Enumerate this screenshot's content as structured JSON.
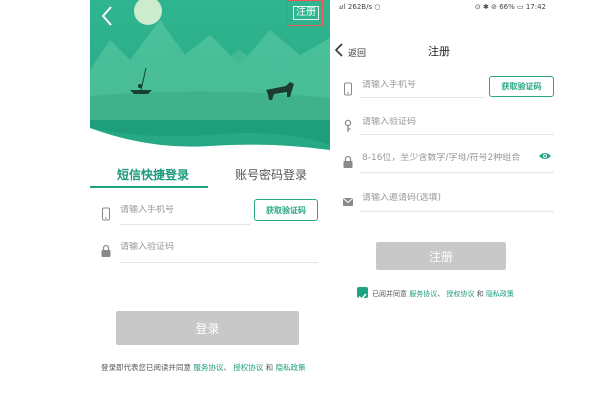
{
  "colors": {
    "accent": "#1ea382",
    "accent_text": "#2aa784",
    "disabled_button": "#c8c8c8",
    "highlight_box": "#ee5555"
  },
  "login": {
    "register_link": "注册",
    "tabs": [
      {
        "label": "短信快捷登录",
        "active": true
      },
      {
        "label": "账号密码登录",
        "active": false
      }
    ],
    "phone_placeholder": "请输入手机号",
    "get_code_label": "获取验证码",
    "code_placeholder": "请输入验证码",
    "login_button": "登录",
    "agreement": {
      "prefix": "登录即代表您已阅读并同意",
      "service": "服务协议",
      "sep": "、",
      "auth": "授权协议",
      "and": "和",
      "privacy": "隐私政策"
    }
  },
  "register": {
    "status_bar": {
      "left": "₄ıl 262B/s ○",
      "right": "⊙ ✱ ⊘ 66% ▭ 17:42"
    },
    "back_label": "返回",
    "title": "注册",
    "phone_placeholder": "请输入手机号",
    "get_code_label": "获取验证码",
    "code_placeholder": "请输入验证码",
    "password_placeholder": "8-16位，至少含数字/字母/符号2种组合",
    "invite_placeholder": "请输入邀请码(选填)",
    "register_button": "注册",
    "agreement": {
      "prefix": "已阅并同意",
      "service": "服务协议",
      "sep": "、",
      "auth": "授权协议",
      "and": "和",
      "privacy": "隐私政策",
      "checked": true
    }
  },
  "icons": [
    "back-arrow-icon",
    "phone-icon",
    "lock-icon",
    "key-icon",
    "envelope-icon",
    "eye-icon",
    "check-icon"
  ]
}
